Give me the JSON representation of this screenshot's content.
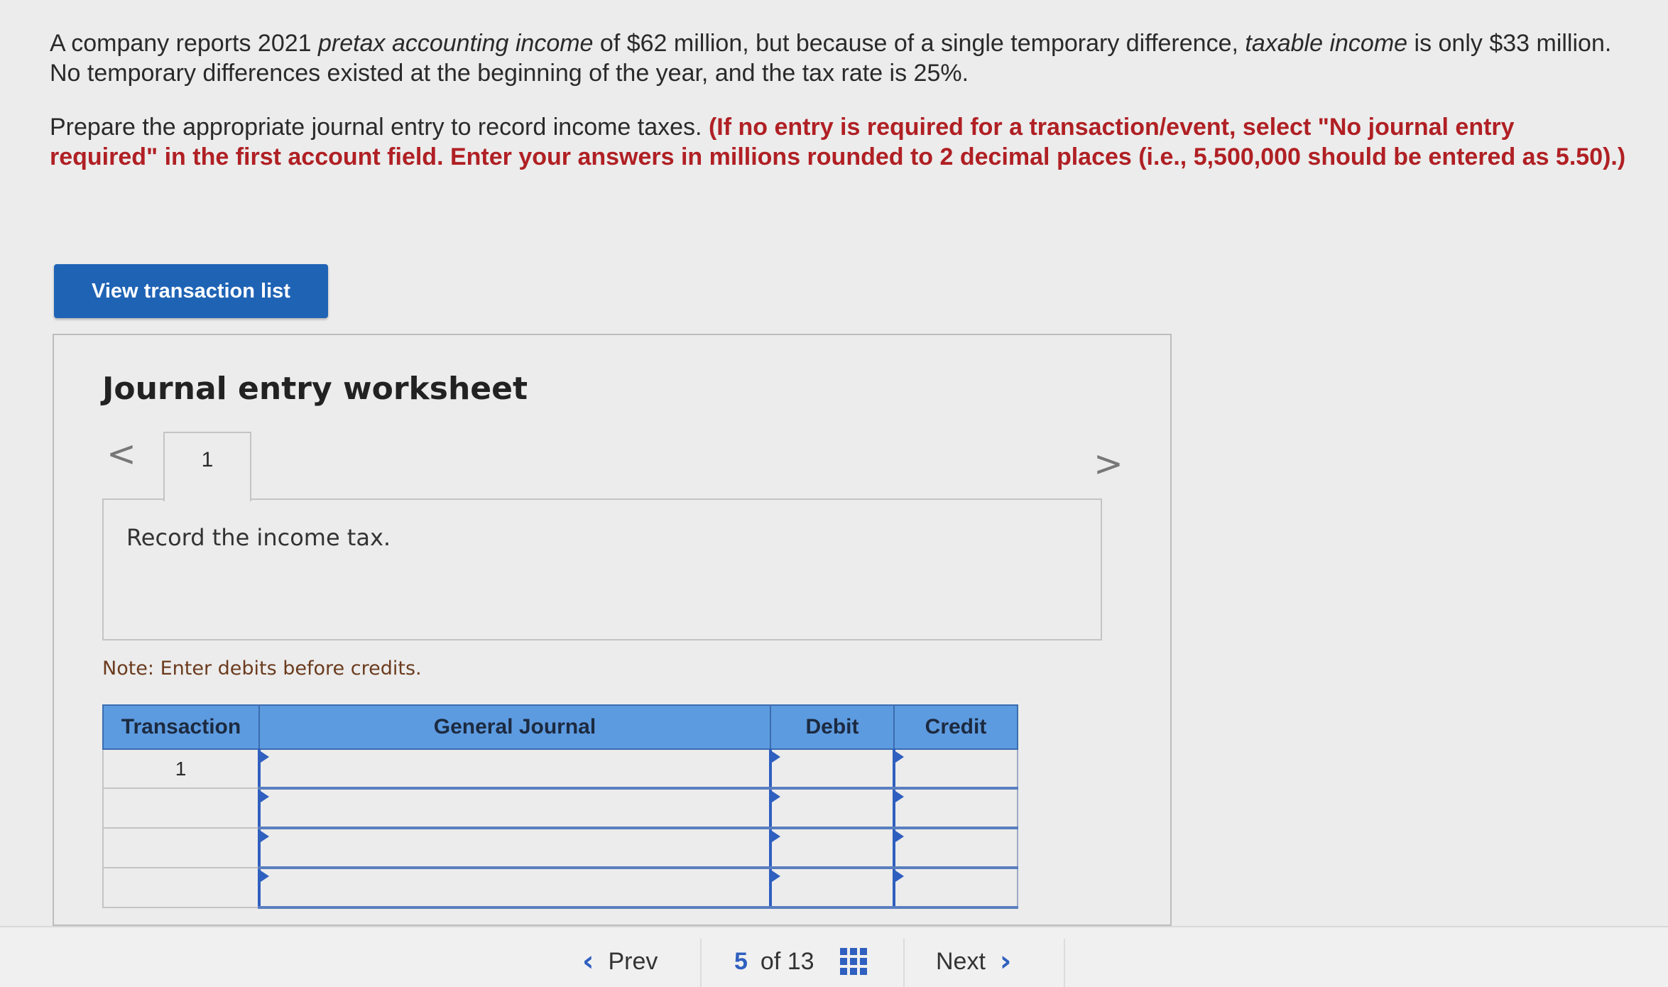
{
  "question": {
    "p1_a": "A company reports 2021 ",
    "p1_em1": "pretax accounting income",
    "p1_b": " of $62 million, but because of a single temporary difference, ",
    "p1_em2": "taxable income",
    "p1_c": " is only $33 million. No temporary differences existed at the beginning of the year, and the tax rate is 25%.",
    "p2_a": "Prepare the appropriate journal entry to record income taxes. ",
    "p2_instr": "(If no entry is required for a transaction/event, select \"No journal entry required\" in the first account field. Enter your answers in millions rounded to 2 decimal places (i.e., 5,500,000 should be entered as 5.50).)"
  },
  "view_button": "View transaction list",
  "worksheet": {
    "title": "Journal entry worksheet",
    "prev_arrow": "<",
    "next_arrow": ">",
    "tab_label": "1",
    "description": "Record the income tax.",
    "note": "Note: Enter debits before credits."
  },
  "journal": {
    "headers": [
      "Transaction",
      "General Journal",
      "Debit",
      "Credit"
    ],
    "first_transaction": "1"
  },
  "footer": {
    "prev": "Prev",
    "current_page": "5",
    "of_label": "of 13",
    "next": "Next"
  },
  "colors": {
    "accent": "#1f63b5",
    "instruction_red": "#b02024",
    "header_blue": "#5d9be0"
  }
}
